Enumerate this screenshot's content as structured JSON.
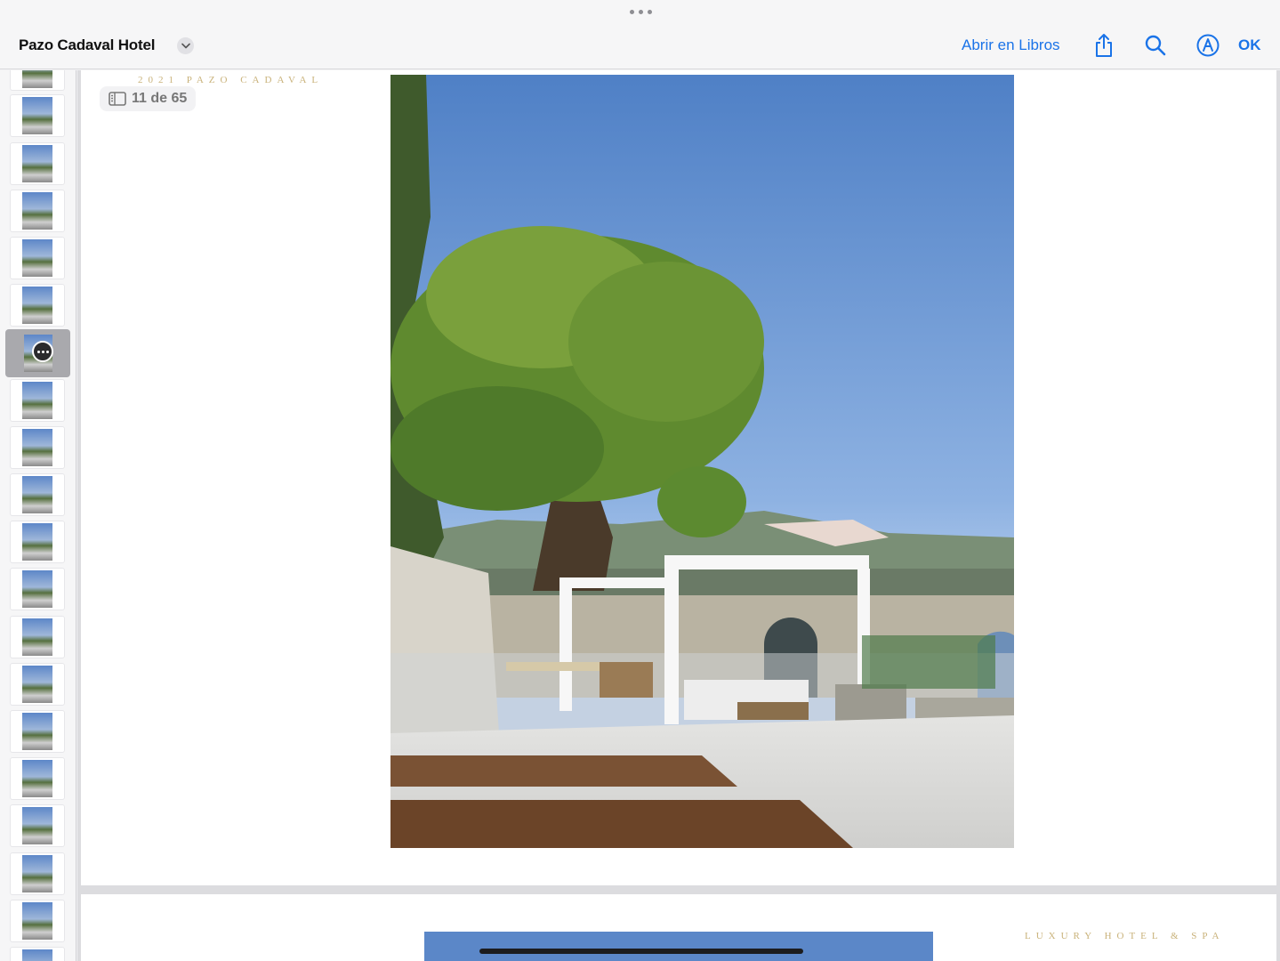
{
  "topbar": {
    "document_title": "Pazo Cadaval Hotel",
    "open_in_books": "Abrir en Libros",
    "done": "OK",
    "icons": {
      "title_menu": "chevron-down-icon",
      "share": "share-icon",
      "search": "search-icon",
      "markup": "markup-icon",
      "grabber": "ellipsis-icon"
    }
  },
  "document": {
    "page_counter": "11 de 65",
    "page_header": "2021 PAZO CADAVAL",
    "next_page_header": "LUXURY HOTEL & SPA"
  },
  "colors": {
    "accent": "#1a73e8",
    "header_gold": "#c9b27a"
  }
}
